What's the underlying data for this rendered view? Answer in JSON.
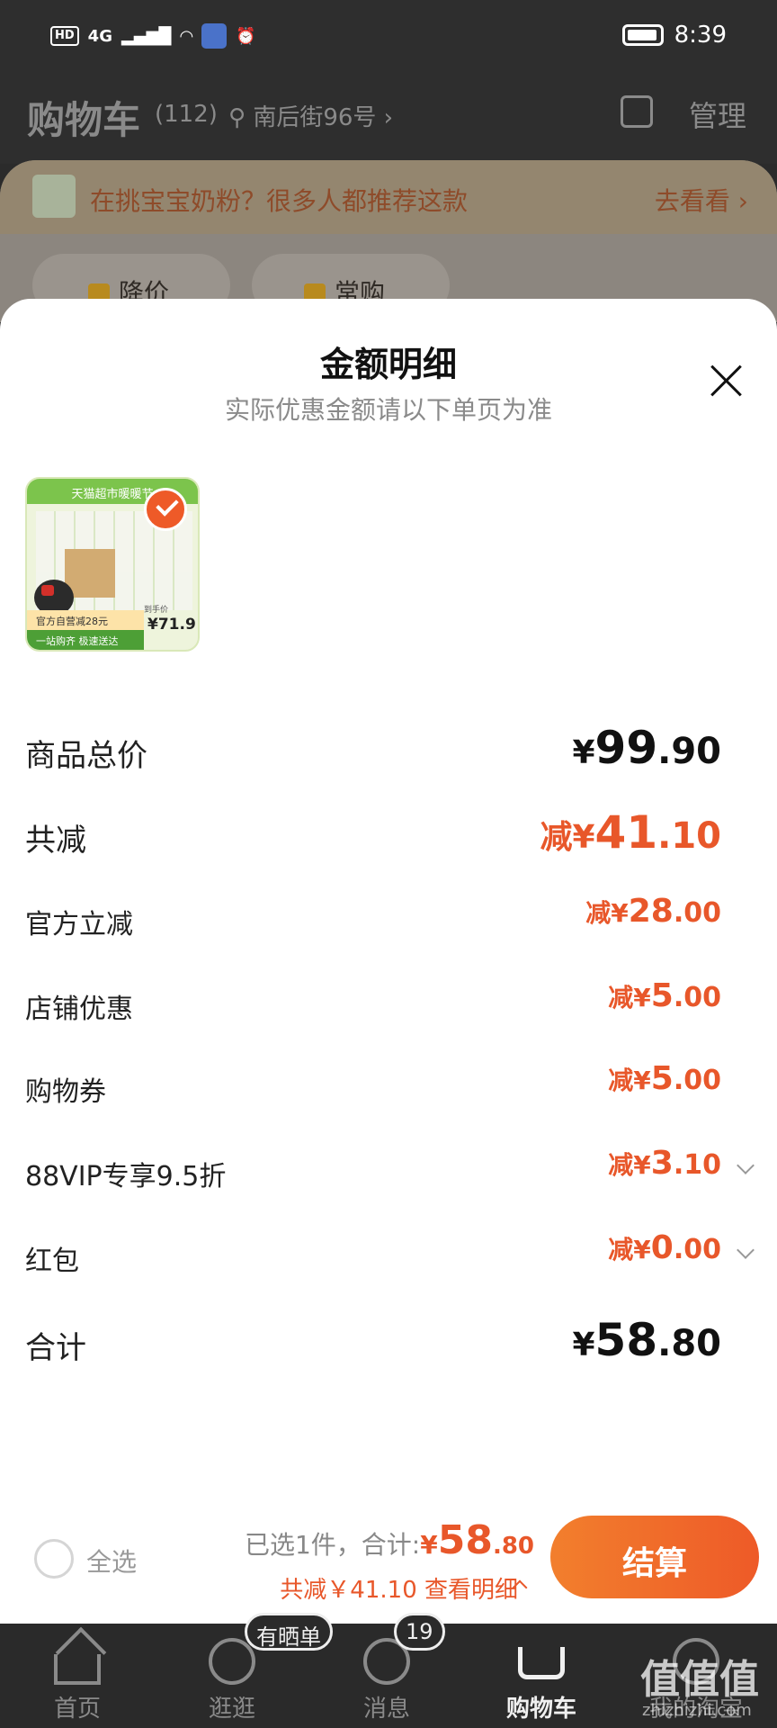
{
  "status_bar": {
    "hd": "HD",
    "net": "4G",
    "time": "8:39"
  },
  "header": {
    "title": "购物车",
    "count": "(112)",
    "address": "南后街96号",
    "manage": "管理"
  },
  "promo": {
    "text": "在挑宝宝奶粉？很多人都推荐这款",
    "link": "去看看",
    "chips": [
      "降价",
      "常购"
    ]
  },
  "sheet": {
    "title": "金额明细",
    "subtitle": "实际优惠金额请以下单页为准",
    "product": {
      "banner": "天猫超市暖暖节",
      "badge_line1": "官方自营减28元",
      "badge_line2": "一站购齐 极速送达",
      "caption": "到手价",
      "price": "71.9"
    },
    "rows": [
      {
        "label": "商品总价",
        "prefix": "",
        "currency": "¥",
        "int": "99",
        "dec": ".90"
      },
      {
        "label": "共减",
        "prefix": "减",
        "currency": "¥",
        "int": "41",
        "dec": ".10"
      },
      {
        "label": "官方立减",
        "prefix": "减",
        "currency": "¥",
        "int": "28",
        "dec": ".00"
      },
      {
        "label": "店铺优惠",
        "prefix": "减",
        "currency": "¥",
        "int": "5",
        "dec": ".00"
      },
      {
        "label": "购物券",
        "prefix": "减",
        "currency": "¥",
        "int": "5",
        "dec": ".00"
      },
      {
        "label": "88VIP专享9.5折",
        "prefix": "减",
        "currency": "¥",
        "int": "3",
        "dec": ".10"
      },
      {
        "label": "红包",
        "prefix": "减",
        "currency": "¥",
        "int": "0",
        "dec": ".00"
      },
      {
        "label": "合计",
        "prefix": "",
        "currency": "¥",
        "int": "58",
        "dec": ".80"
      }
    ]
  },
  "checkout": {
    "select_all": "全选",
    "selected": "已选1件，合计:",
    "currency": "¥",
    "total_int": "58",
    "total_dec": ".80",
    "saved": "共减￥41.10 查看明细",
    "pay_button": "结算"
  },
  "tabbar": {
    "tabs": [
      "首页",
      "逛逛",
      "消息",
      "购物车",
      "我的淘宝"
    ],
    "stroll_badge": "有晒单",
    "msg_badge": "19"
  },
  "watermark": {
    "main": "值值值",
    "sub": "zhizhizhi.com"
  }
}
